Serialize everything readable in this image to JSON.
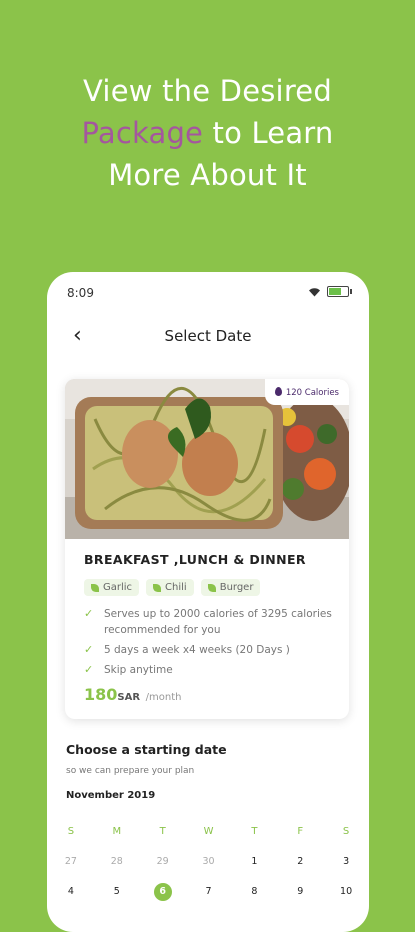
{
  "headline": {
    "line1": "View the Desired",
    "highlight": "Package",
    "line2_rest": " to Learn",
    "line3": "More About It"
  },
  "status": {
    "time": "8:09"
  },
  "nav": {
    "back_glyph": "‹",
    "title": "Select Date"
  },
  "card": {
    "calories_badge": "120 Calories",
    "meal_title": "BREAKFAST ,LUNCH & DINNER",
    "tags": [
      {
        "label": "Garlic"
      },
      {
        "label": "Chili"
      },
      {
        "label": "Burger"
      }
    ],
    "features": [
      "Serves up to 2000 calories of 3295 calories recommended for you",
      "5 days a week x4 weeks (20 Days )",
      "Skip anytime"
    ],
    "price": {
      "amount": "180",
      "currency": "SAR",
      "period": "/month"
    }
  },
  "schedule": {
    "title": "Choose a starting date",
    "subtitle": "so we can prepare your plan",
    "month": "November 2019",
    "weekdays": [
      "S",
      "M",
      "T",
      "W",
      "T",
      "F",
      "S"
    ],
    "rows": [
      [
        "27",
        "28",
        "29",
        "30",
        "1",
        "2",
        "3"
      ],
      [
        "4",
        "5",
        "6",
        "7",
        "8",
        "9",
        "10"
      ]
    ],
    "selected": "6"
  },
  "colors": {
    "accent": "#8bc34a",
    "highlight": "#a4579e",
    "badge_text": "#4b2a6b"
  }
}
